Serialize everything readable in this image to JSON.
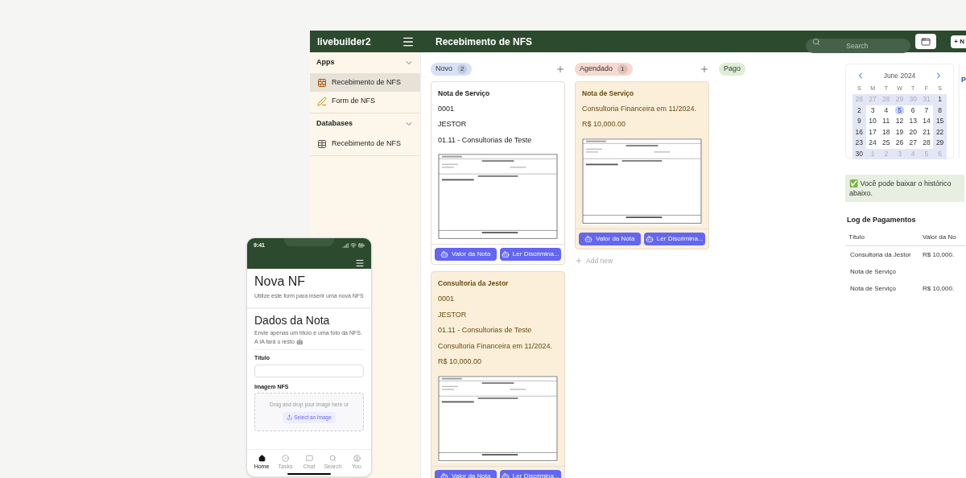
{
  "app": {
    "name": "livebuilder2",
    "page_title": "Recebimento de NFS",
    "search": {
      "placeholder": "Search"
    },
    "new_button": "+ N"
  },
  "sidebar": [
    {
      "title": "Apps",
      "expanded": true,
      "items": [
        {
          "label": "Recebimento de NFS",
          "selected": true
        },
        {
          "label": "Form de NFS",
          "selected": false
        }
      ]
    },
    {
      "title": "Databases",
      "expanded": true,
      "items": [
        {
          "label": "Recebimento de NFS",
          "selected": false
        }
      ]
    }
  ],
  "columns": [
    {
      "title": "Novo",
      "count": "2",
      "color": "#d7e1f6",
      "add": true,
      "cards": [
        {
          "color": "#ffffff",
          "title": "Nota de Serviço",
          "lines": [
            "0001",
            "JESTOR",
            "01.11 - Consultorias de Teste"
          ],
          "buttons": [
            "Valor da Nota",
            "Ler Discrimina..."
          ]
        },
        {
          "color": "#fbefd9",
          "title": "Consultoria da Jestor",
          "lines": [
            "0001",
            "JESTOR",
            "01.11 - Consultorias de Teste",
            "Consultoria Financeira em 11/2024.",
            "R$ 10,000.00"
          ],
          "buttons": [
            "Valor da Nota",
            "Ler Discrimina..."
          ]
        }
      ]
    },
    {
      "title": "Agendado",
      "count": "1",
      "color": "#f6d9cf",
      "add": true,
      "add_new": "Add new",
      "cards": [
        {
          "color": "#fbefd9",
          "title": "Nota de Serviço",
          "lines": [
            "Consultoria Financeira em 11/2024.",
            "R$ 10,000.00"
          ],
          "buttons": [
            "Valor da Nota",
            "Ler Discrimina..."
          ]
        }
      ]
    },
    {
      "title": "Pago",
      "color": "#dcefd6",
      "add": false
    }
  ],
  "calendar": {
    "month": "June 2024",
    "weekdays": [
      "S",
      "M",
      "T",
      "W",
      "T",
      "F",
      "S"
    ],
    "weeks": [
      [
        {
          "label": "26",
          "muted": true,
          "highlighted": true,
          "selected": false
        },
        {
          "label": "27",
          "muted": true,
          "highlighted": true,
          "selected": false
        },
        {
          "label": "28",
          "muted": true,
          "highlighted": true,
          "selected": false
        },
        {
          "label": "29",
          "muted": true,
          "highlighted": true,
          "selected": false
        },
        {
          "label": "30",
          "muted": true,
          "highlighted": true,
          "selected": false
        },
        {
          "label": "31",
          "muted": true,
          "highlighted": true,
          "selected": false
        },
        {
          "label": "1",
          "muted": false,
          "highlighted": true,
          "selected": false
        }
      ],
      [
        {
          "label": "2",
          "muted": false,
          "highlighted": true,
          "selected": false
        },
        {
          "label": "3",
          "muted": false,
          "highlighted": false,
          "selected": false
        },
        {
          "label": "4",
          "muted": false,
          "highlighted": false,
          "selected": false
        },
        {
          "label": "5",
          "muted": false,
          "highlighted": false,
          "selected": true
        },
        {
          "label": "6",
          "muted": false,
          "highlighted": false,
          "selected": false
        },
        {
          "label": "7",
          "muted": false,
          "highlighted": false,
          "selected": false
        },
        {
          "label": "8",
          "muted": false,
          "highlighted": true,
          "selected": false
        }
      ],
      [
        {
          "label": "9",
          "muted": false,
          "highlighted": true,
          "selected": false
        },
        {
          "label": "10",
          "muted": false,
          "highlighted": false,
          "selected": false
        },
        {
          "label": "11",
          "muted": false,
          "highlighted": false,
          "selected": false
        },
        {
          "label": "12",
          "muted": false,
          "highlighted": false,
          "selected": false
        },
        {
          "label": "13",
          "muted": false,
          "highlighted": false,
          "selected": false
        },
        {
          "label": "14",
          "muted": false,
          "highlighted": false,
          "selected": false
        },
        {
          "label": "15",
          "muted": false,
          "highlighted": true,
          "selected": false
        }
      ],
      [
        {
          "label": "16",
          "muted": false,
          "highlighted": true,
          "selected": false
        },
        {
          "label": "17",
          "muted": false,
          "highlighted": false,
          "selected": false
        },
        {
          "label": "18",
          "muted": false,
          "highlighted": false,
          "selected": false
        },
        {
          "label": "19",
          "muted": false,
          "highlighted": false,
          "selected": false
        },
        {
          "label": "20",
          "muted": false,
          "highlighted": false,
          "selected": false
        },
        {
          "label": "21",
          "muted": false,
          "highlighted": false,
          "selected": false
        },
        {
          "label": "22",
          "muted": false,
          "highlighted": true,
          "selected": false
        }
      ],
      [
        {
          "label": "23",
          "muted": false,
          "highlighted": true,
          "selected": false
        },
        {
          "label": "24",
          "muted": false,
          "highlighted": false,
          "selected": false
        },
        {
          "label": "25",
          "muted": false,
          "highlighted": false,
          "selected": false
        },
        {
          "label": "26",
          "muted": false,
          "highlighted": false,
          "selected": false
        },
        {
          "label": "27",
          "muted": false,
          "highlighted": false,
          "selected": false
        },
        {
          "label": "28",
          "muted": false,
          "highlighted": false,
          "selected": false
        },
        {
          "label": "29",
          "muted": false,
          "highlighted": true,
          "selected": false
        }
      ],
      [
        {
          "label": "30",
          "muted": false,
          "highlighted": true,
          "selected": false
        },
        {
          "label": "1",
          "muted": true,
          "highlighted": true,
          "selected": false
        },
        {
          "label": "2",
          "muted": true,
          "highlighted": true,
          "selected": false
        },
        {
          "label": "3",
          "muted": true,
          "highlighted": true,
          "selected": false
        },
        {
          "label": "4",
          "muted": true,
          "highlighted": true,
          "selected": false
        },
        {
          "label": "5",
          "muted": true,
          "highlighted": true,
          "selected": false
        },
        {
          "label": "6",
          "muted": true,
          "highlighted": true,
          "selected": false
        }
      ]
    ]
  },
  "side_panel_label": "P",
  "notice": "✅ Você pode baixar o histórico abaixo.",
  "log": {
    "title": "Log de Pagamentos",
    "columns": [
      "Título",
      "Valor da No"
    ],
    "rows": [
      {
        "title": "Consultoria da Jestor",
        "value": "R$ 10,000."
      },
      {
        "title": "Nota de Serviço"
      },
      {
        "title": "Nota de Serviço",
        "value": "R$ 10,000."
      }
    ]
  },
  "phone": {
    "time": "9:41",
    "title": "Nova NF",
    "subtitle": "Utilize este form para inserir uma nova NFS",
    "section_title": "Dados da Nota",
    "section_text": "Envie apenas um título e uma foto da NFS. A IA fará o resto 🤖",
    "fields": [
      {
        "kind": "text",
        "label": "Título"
      },
      {
        "label": "Imagem NFS",
        "hint": "Drag and drop your image here or",
        "button": "Select an image"
      }
    ],
    "tabs": [
      {
        "label": "Home",
        "selected": true
      },
      {
        "label": "Tasks",
        "selected": false
      },
      {
        "label": "Chat",
        "selected": false
      },
      {
        "label": "Search",
        "selected": false
      },
      {
        "label": "You",
        "selected": false
      }
    ]
  }
}
